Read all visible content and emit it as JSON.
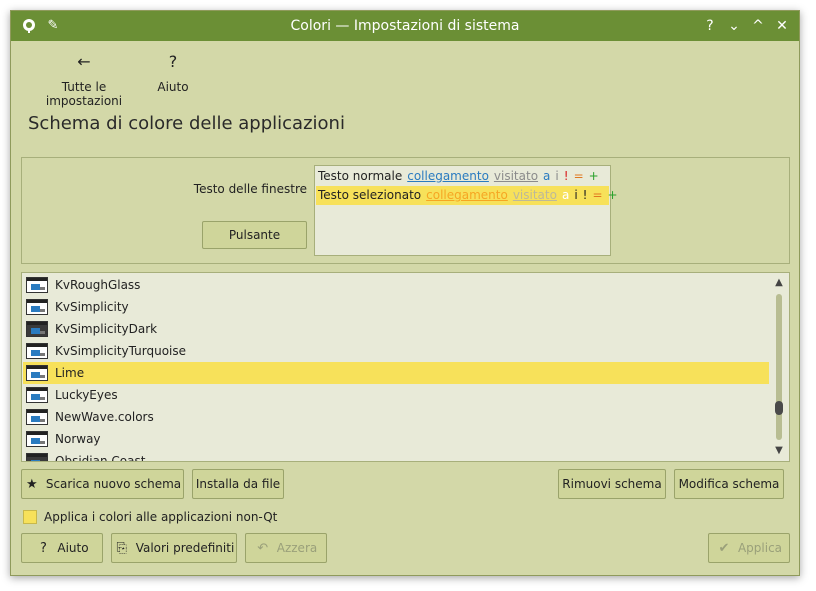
{
  "window": {
    "title": "Colori — Impostazioni di sistema",
    "controls": {
      "help": "?",
      "minimize": "⌄",
      "maximize": "^",
      "close": "✕"
    }
  },
  "nav": {
    "back_label": "Tutte le impostazioni",
    "back_icon": "arrow-left-icon",
    "help_label": "Aiuto",
    "help_icon": "question-icon"
  },
  "page_title": "Schema di colore delle applicazioni",
  "preview": {
    "window_text_label": "Testo delle finestre",
    "button_label": "Pulsante",
    "normal_row": {
      "text": "Testo normale",
      "link": "collegamento",
      "visited": "visitato",
      "active": "a",
      "inactive": "i",
      "negative": "!",
      "neutral": "=",
      "positive": "+"
    },
    "selected_row": {
      "text": "Testo selezionato",
      "link": "collegamento",
      "visited": "visitato",
      "active": "a",
      "inactive": "i",
      "negative": "!",
      "neutral": "=",
      "positive": "+"
    }
  },
  "schemes": {
    "items": [
      {
        "name": "KvRoughGlass",
        "dark": false
      },
      {
        "name": "KvSimplicity",
        "dark": false
      },
      {
        "name": "KvSimplicityDark",
        "dark": true
      },
      {
        "name": "KvSimplicityTurquoise",
        "dark": false
      },
      {
        "name": "Lime",
        "dark": false
      },
      {
        "name": "LuckyEyes",
        "dark": false
      },
      {
        "name": "NewWave.colors",
        "dark": false
      },
      {
        "name": "Norway",
        "dark": false
      },
      {
        "name": "Obsidian Coast",
        "dark": true
      }
    ],
    "selected": "Lime"
  },
  "actions": {
    "download_new": "Scarica nuovo schema",
    "install_from_file": "Installa da file",
    "remove": "Rimuovi schema",
    "edit": "Modifica schema"
  },
  "apply_non_qt": {
    "label": "Applica i colori alle applicazioni non-Qt",
    "checked": false
  },
  "footer": {
    "help": "Aiuto",
    "defaults": "Valori predefiniti",
    "reset": "Azzera",
    "apply": "Applica"
  },
  "colors": {
    "titlebar": "#6b8f35",
    "window_bg": "#d3d8a8",
    "view_bg": "#e8ead8",
    "selection": "#f7e15a",
    "link": "#2a7bc0",
    "negative": "#d81c1c",
    "neutral": "#e07820",
    "positive": "#27a02a"
  }
}
